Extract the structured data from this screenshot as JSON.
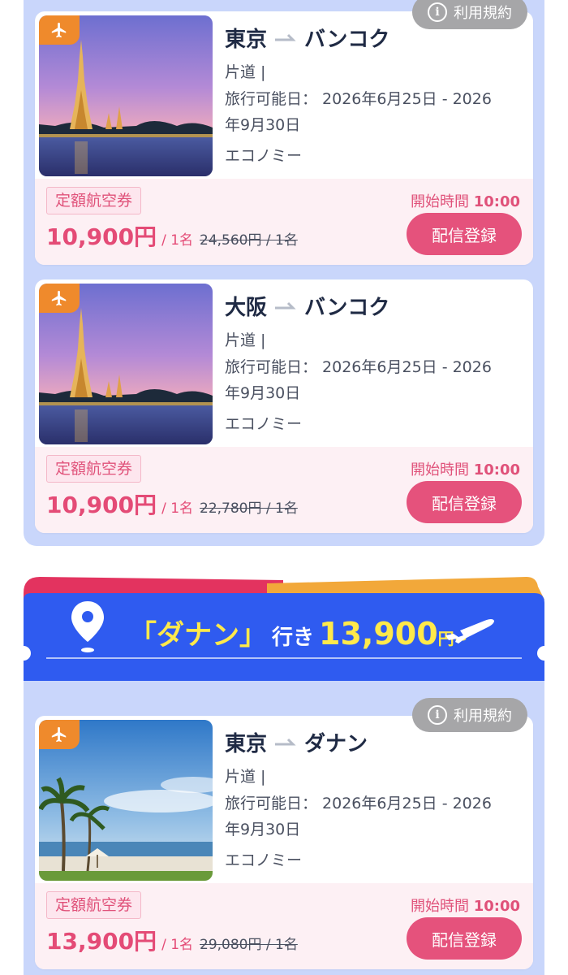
{
  "terms_label": "利用規約",
  "banner": {
    "destination": "「ダナン」",
    "suffix": "行き",
    "price": "13,900",
    "yen": "円~",
    "colors": {
      "blue": "#2f5bf0",
      "yellow": "#ffe94a"
    }
  },
  "cards": [
    {
      "from": "東京",
      "to": "バンコク",
      "trip_type": "片道 |",
      "travel_dates_line1": "旅行可能日： 2026年6月25日  - 2026",
      "travel_dates_line2": "年9月30日",
      "cabin": "エコノミー",
      "tag": "定額航空券",
      "price": "10,900円",
      "per": "/ 1名",
      "original_price": "24,560円 / 1名",
      "start_label": "開始時間",
      "start_time": "10:00",
      "cta": "配信登録",
      "image": "bangkok-temple"
    },
    {
      "from": "大阪",
      "to": "バンコク",
      "trip_type": "片道 |",
      "travel_dates_line1": "旅行可能日： 2026年6月25日  - 2026",
      "travel_dates_line2": "年9月30日",
      "cabin": "エコノミー",
      "tag": "定額航空券",
      "price": "10,900円",
      "per": "/ 1名",
      "original_price": "22,780円 / 1名",
      "start_label": "開始時間",
      "start_time": "10:00",
      "cta": "配信登録",
      "image": "bangkok-temple"
    },
    {
      "from": "東京",
      "to": "ダナン",
      "trip_type": "片道 |",
      "travel_dates_line1": "旅行可能日： 2026年6月25日  - 2026",
      "travel_dates_line2": "年9月30日",
      "cabin": "エコノミー",
      "tag": "定額航空券",
      "price": "13,900円",
      "per": "/ 1名",
      "original_price": "29,080円 / 1名",
      "start_label": "開始時間",
      "start_time": "10:00",
      "cta": "配信登録",
      "image": "danang-beach"
    }
  ],
  "colors": {
    "panel": "#c9d6fb",
    "accent_pink": "#e5527c",
    "badge_orange": "#ef8a2c",
    "terms_grey": "#a6a6a8"
  }
}
